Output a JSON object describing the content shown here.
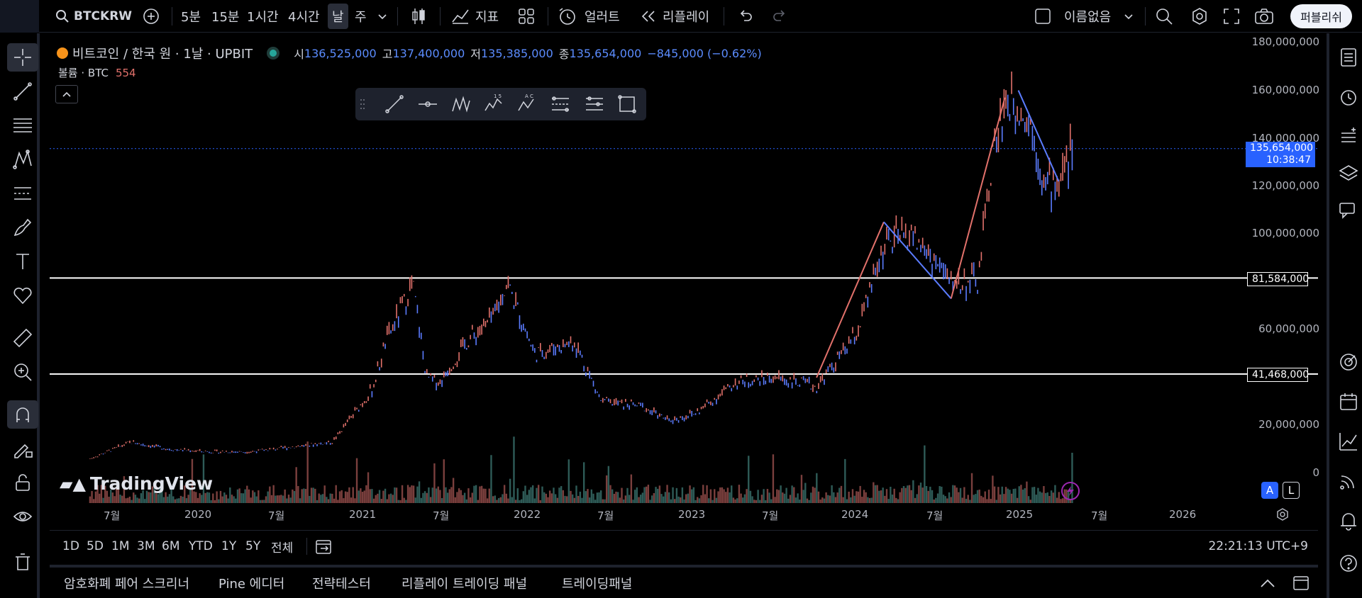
{
  "topbar": {
    "symbol": "BTCKRW",
    "intervals": [
      "5분",
      "15분",
      "1시간",
      "4시간",
      "날",
      "주"
    ],
    "active_interval": "날",
    "indicators_label": "지표",
    "alert_label": "얼러트",
    "replay_label": "리플레이",
    "layout_name": "이름없음",
    "publish_label": "퍼블리쉬"
  },
  "legend": {
    "title": "비트코인 / 한국 원 · 1날 · UPBIT",
    "open_label": "시",
    "open": "136,525,000",
    "high_label": "고",
    "high": "137,400,000",
    "low_label": "저",
    "low": "135,385,000",
    "close_label": "종",
    "close": "135,654,000",
    "change": "−845,000 (−0.62%)",
    "volume_label": "볼륨 · BTC",
    "volume_value": "554"
  },
  "price_axis": {
    "labels": [
      "180,000,000",
      "160,000,000",
      "140,000,000",
      "120,000,000",
      "100,000,000",
      "60,000,000",
      "20,000,000",
      "0"
    ],
    "current_price": "135,654,000",
    "countdown": "10:38:47",
    "hline_1": "81,584,000",
    "hline_2": "41,468,000"
  },
  "time_axis": {
    "labels": [
      "7월",
      "2020",
      "7월",
      "2021",
      "7월",
      "2022",
      "7월",
      "2023",
      "7월",
      "2024",
      "7월",
      "2025",
      "7월",
      "2026"
    ]
  },
  "axis_buttons": {
    "auto": "A",
    "log": "L"
  },
  "watermark": "TradingView",
  "range_bar": {
    "ranges": [
      "1D",
      "5D",
      "1M",
      "3M",
      "6M",
      "YTD",
      "1Y",
      "5Y",
      "전체"
    ],
    "clock": "22:21:13 UTC+9"
  },
  "panel_bar": {
    "tabs": [
      "암호화폐 페어 스크리너",
      "Pine 에디터",
      "전략테스터",
      "리플레이 트레이딩 패널",
      "트레이딩패널"
    ]
  },
  "colors": {
    "accent": "#5b8cff",
    "up": "#e2716b",
    "down": "#5b7cff",
    "price_tag_bg": "#2962ff"
  },
  "chart_data": {
    "type": "line",
    "x": [
      "2019-04",
      "2019-07",
      "2019-10",
      "2020-01",
      "2020-04",
      "2020-07",
      "2020-10",
      "2021-01",
      "2021-02",
      "2021-04",
      "2021-05",
      "2021-06",
      "2021-08",
      "2021-10",
      "2021-11",
      "2022-01",
      "2022-04",
      "2022-06",
      "2022-09",
      "2022-11",
      "2023-01",
      "2023-04",
      "2023-07",
      "2023-10",
      "2024-01",
      "2024-03",
      "2024-05",
      "2024-08",
      "2024-10",
      "2024-11",
      "2024-12",
      "2025-01",
      "2025-02",
      "2025-03",
      "2025-04",
      "2025-05"
    ],
    "y": [
      6000000,
      13000000,
      10000000,
      9000000,
      9000000,
      11000000,
      13000000,
      35000000,
      55000000,
      79000000,
      40000000,
      38000000,
      55000000,
      65000000,
      80000000,
      50000000,
      55000000,
      30000000,
      28000000,
      22000000,
      25000000,
      38000000,
      40000000,
      36000000,
      58000000,
      95000000,
      100000000,
      80000000,
      80000000,
      130000000,
      155000000,
      155000000,
      145000000,
      120000000,
      122000000,
      135654000
    ],
    "ylim": [
      0,
      180000000
    ],
    "hlines": [
      81584000,
      41468000
    ],
    "grid": false
  }
}
